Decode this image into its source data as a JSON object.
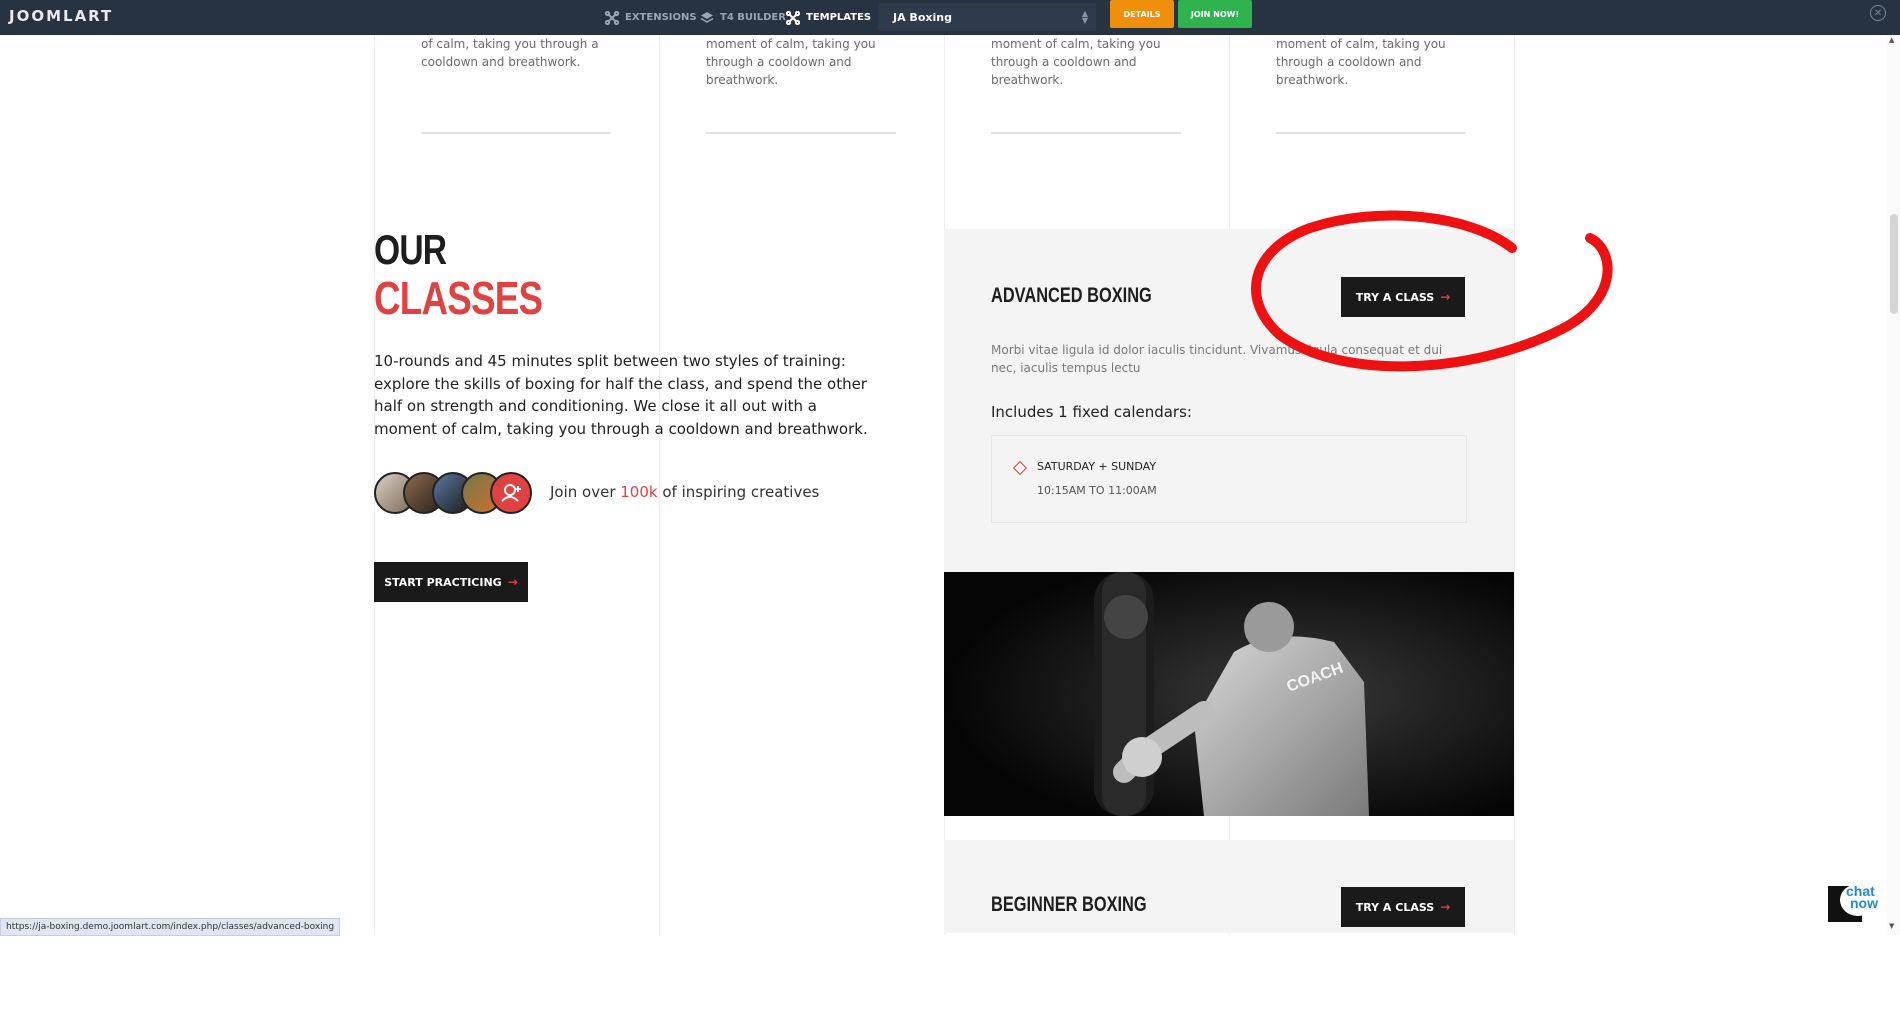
{
  "topbar": {
    "logo": "JOOMLART",
    "nav": [
      {
        "label": "EXTENSIONS",
        "icon": "joomla-icon"
      },
      {
        "label": "T4 BUILDER",
        "icon": "layers-icon"
      },
      {
        "label": "TEMPLATES",
        "icon": "joomla-icon"
      }
    ],
    "template_select": "JA Boxing",
    "details_label": "DETAILS",
    "join_label": "JOIN NOW!",
    "close_icon": "close-icon"
  },
  "top_cards": [
    {
      "text": "of calm, taking you through a cooldown and breathwork."
    },
    {
      "text": "moment of calm, taking you through a cooldown and breathwork."
    },
    {
      "text": "moment of calm, taking you through a cooldown and breathwork."
    },
    {
      "text": "moment of calm, taking you through a cooldown and breathwork."
    }
  ],
  "classes": {
    "heading_line1": "OUR",
    "heading_line2": "CLASSES",
    "intro": "10-rounds and 45 minutes split between two styles of training: explore the skills of boxing for half the class, and spend the other half on strength and conditioning. We close it all out with a moment of calm, taking you through a cooldown and breathwork.",
    "join_prefix": "Join over ",
    "join_highlight": "100k",
    "join_suffix": " of inspiring creatives",
    "start_label": "START PRACTICING"
  },
  "class_cards": [
    {
      "title": "ADVANCED BOXING",
      "button": "TRY A CLASS",
      "description": "Morbi vitae ligula id dolor iaculis tincidunt. Vivamus ligula consequat et dui nec, iaculis tempus lectu",
      "includes": "Includes 1 fixed calendars:",
      "days": "SATURDAY + SUNDAY",
      "times": "10:15AM TO 11:00AM"
    },
    {
      "title": "BEGINNER BOXING",
      "button": "TRY A CLASS"
    }
  ],
  "status_url": "https://ja-boxing.demo.joomlart.com/index.php/classes/advanced-boxing",
  "chat": {
    "line1": "chat",
    "line2": "now"
  },
  "colors": {
    "accent": "#e04141",
    "dark": "#1a1a1a",
    "topbar": "#283342",
    "details": "#f0900a",
    "join": "#2fb34f"
  }
}
